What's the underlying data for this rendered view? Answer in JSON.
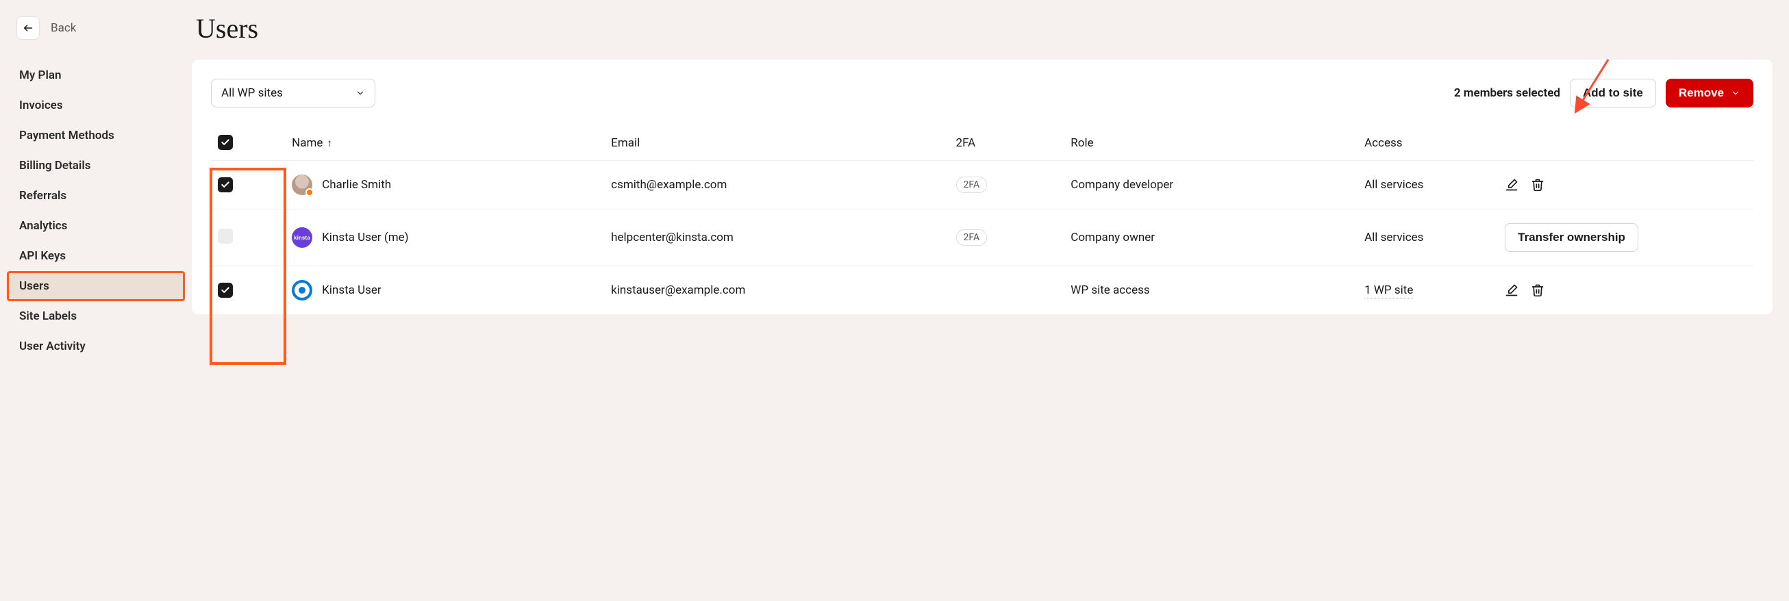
{
  "back_label": "Back",
  "sidebar": {
    "items": [
      {
        "label": "My Plan"
      },
      {
        "label": "Invoices"
      },
      {
        "label": "Payment Methods"
      },
      {
        "label": "Billing Details"
      },
      {
        "label": "Referrals"
      },
      {
        "label": "Analytics"
      },
      {
        "label": "API Keys"
      },
      {
        "label": "Users"
      },
      {
        "label": "Site Labels"
      },
      {
        "label": "User Activity"
      }
    ],
    "active_index": 7
  },
  "page_title": "Users",
  "toolbar": {
    "filter_label": "All WP sites",
    "selected_text": "2 members selected",
    "add_label": "Add to site",
    "remove_label": "Remove"
  },
  "table": {
    "headers": {
      "name": "Name",
      "email": "Email",
      "twofa": "2FA",
      "role": "Role",
      "access": "Access"
    },
    "select_all_checked": true,
    "rows": [
      {
        "checked": true,
        "avatar_type": "photo",
        "avatar_badge": true,
        "name": "Charlie Smith",
        "email": "csmith@example.com",
        "twofa": "2FA",
        "role": "Company developer",
        "access": "All services",
        "actions": "edit_delete"
      },
      {
        "checked": false,
        "avatar_type": "purple",
        "avatar_text": "kinsta",
        "name": "Kinsta User (me)",
        "email": "helpcenter@kinsta.com",
        "twofa": "2FA",
        "role": "Company owner",
        "access": "All services",
        "actions": "transfer",
        "transfer_label": "Transfer ownership"
      },
      {
        "checked": true,
        "avatar_type": "blue-ring",
        "name": "Kinsta User",
        "email": "kinstauser@example.com",
        "twofa": "",
        "role": "WP site access",
        "access": "1 WP site",
        "access_link": true,
        "actions": "edit_delete"
      }
    ]
  }
}
